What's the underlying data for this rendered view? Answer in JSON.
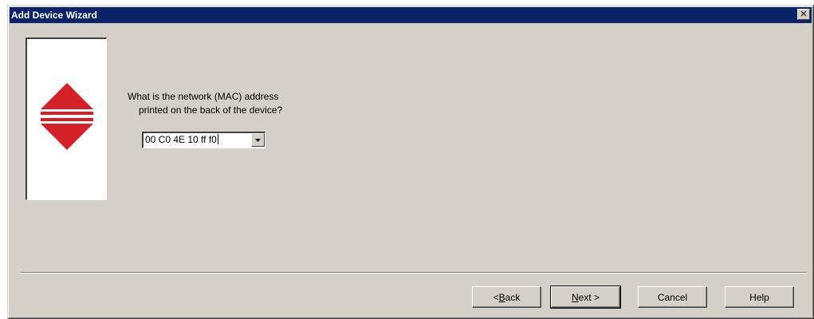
{
  "window": {
    "title": "Add Device Wizard",
    "close_glyph": "✕"
  },
  "logo": {
    "icon": "red-diamond-logo-icon",
    "color": "#d42027"
  },
  "question": {
    "line1": "What is the network (MAC) address",
    "line2": "printed on the back of the device?"
  },
  "mac_input": {
    "value": "00 C0 4E 10 ff f0"
  },
  "buttons": {
    "back": {
      "prefix": "< ",
      "accel": "B",
      "rest": "ack"
    },
    "next": {
      "accel": "N",
      "rest": "ext >"
    },
    "cancel": "Cancel",
    "help": "Help"
  },
  "colors": {
    "titlebar": "#0a246a",
    "face": "#d4d0c8"
  }
}
